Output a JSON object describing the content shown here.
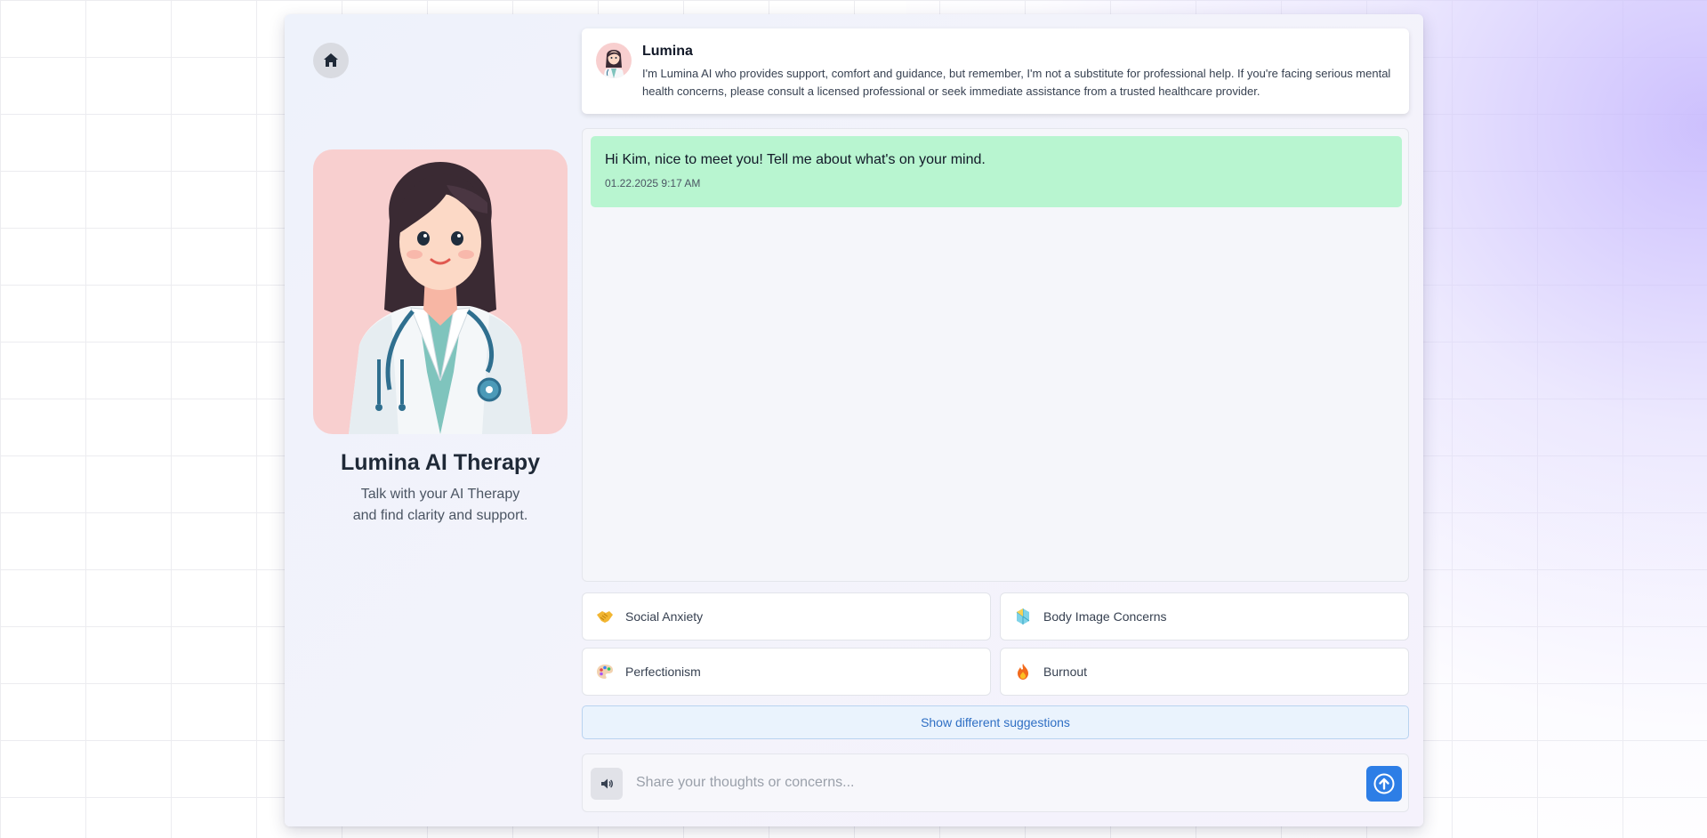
{
  "colors": {
    "accent": "#2d7ee6",
    "message_bg": "#b8f5d0",
    "avatar_bg": "#f8cfcf",
    "suggest_link": "#2f6fc4"
  },
  "sidebar": {
    "home_icon": "home-icon",
    "title": "Lumina AI Therapy",
    "subtitle_line1": "Talk with your AI Therapy",
    "subtitle_line2": "and find clarity and support.",
    "avatar_alt": "therapist-avatar"
  },
  "header": {
    "name": "Lumina",
    "description": "I'm Lumina AI who provides support, comfort and guidance, but remember, I'm not a substitute for professional help. If you're facing serious mental health concerns, please consult a licensed professional or seek immediate assistance from a trusted healthcare provider."
  },
  "chat": {
    "messages": [
      {
        "text": "Hi Kim, nice to meet you! Tell me about what's on your mind.",
        "time": "01.22.2025 9:17 AM"
      }
    ]
  },
  "suggestions": [
    {
      "label": "Social Anxiety",
      "icon": "handshake-icon"
    },
    {
      "label": "Body Image Concerns",
      "icon": "crystal-icon"
    },
    {
      "label": "Perfectionism",
      "icon": "palette-icon"
    },
    {
      "label": "Burnout",
      "icon": "fire-icon"
    }
  ],
  "more_suggestions_label": "Show different suggestions",
  "composer": {
    "placeholder": "Share your thoughts or concerns...",
    "speaker_icon": "speaker-icon",
    "send_icon": "send-arrow-icon"
  }
}
